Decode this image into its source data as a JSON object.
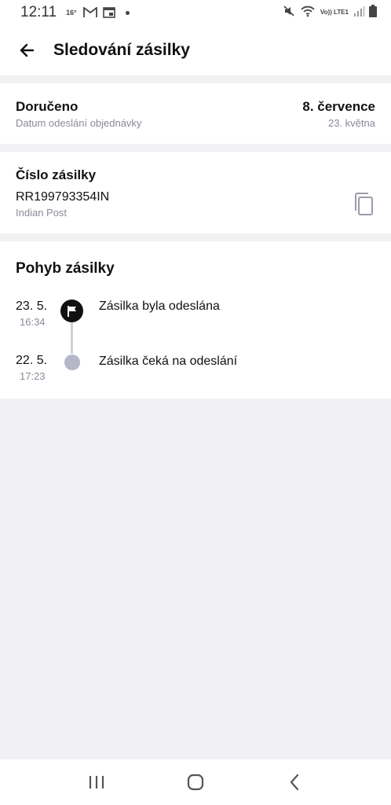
{
  "status_bar": {
    "time": "12:11",
    "temp": "16°",
    "icons": [
      "gmail-icon",
      "calendar-icon",
      "dot-icon",
      "mute-icon",
      "wifi-icon",
      "volte-icon",
      "signal-icon",
      "battery-icon"
    ],
    "volte_label": "Vo)) LTE1"
  },
  "app_bar": {
    "title": "Sledování zásilky",
    "back_icon": "arrow-back-icon"
  },
  "delivery": {
    "status": "Doručeno",
    "status_sub": "Datum odeslání objednávky",
    "date": "8. července",
    "date_sub": "23. května"
  },
  "shipment": {
    "heading": "Číslo zásilky",
    "number": "RR199793354IN",
    "carrier": "Indian Post",
    "copy_icon": "copy-icon"
  },
  "movement": {
    "heading": "Pohyb zásilky",
    "events": [
      {
        "date": "23. 5.",
        "time": "16:34",
        "text": "Zásilka byla odeslána",
        "icon": "flag-icon"
      },
      {
        "date": "22. 5.",
        "time": "17:23",
        "text": "Zásilka čeká na odeslání",
        "icon": "dot-icon"
      }
    ]
  },
  "nav_bar": {
    "buttons": [
      "recent-apps-icon",
      "home-icon",
      "back-icon"
    ]
  }
}
